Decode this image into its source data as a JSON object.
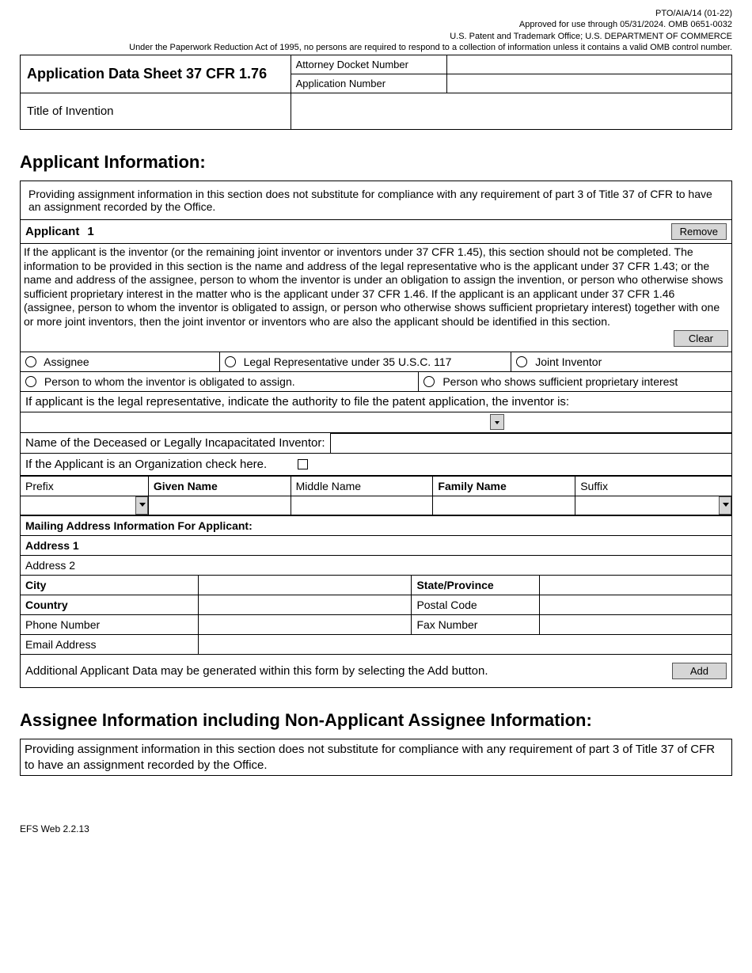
{
  "meta": {
    "form_id": "PTO/AIA/14 (01-22)",
    "approval": "Approved for use through 05/31/2024.  OMB 0651-0032",
    "agency": "U.S. Patent and Trademark Office; U.S. DEPARTMENT OF COMMERCE",
    "pra": "Under the Paperwork Reduction Act of 1995, no persons are required to respond to a collection of information unless it contains a valid OMB control number."
  },
  "header": {
    "title": "Application Data Sheet 37 CFR 1.76",
    "docket_label": "Attorney Docket Number",
    "appnum_label": "Application Number",
    "title_of_invention_label": "Title of Invention",
    "docket_value": "",
    "appnum_value": "",
    "title_value": ""
  },
  "section_applicant_title": "Applicant Information:",
  "assignment_note": "Providing assignment information in this section does not substitute for compliance with any requirement of part 3 of Title 37 of CFR to have an assignment recorded by the Office.",
  "applicant_label": "Applicant",
  "applicant_number": "1",
  "remove_label": "Remove",
  "clear_label": "Clear",
  "applicant_longtext": "If the applicant is the inventor (or the remaining joint inventor or inventors under 37 CFR 1.45), this section should not be completed. The information to be provided in this section is the name and address of the legal representative who is the applicant under 37 CFR 1.43; or the name and address of the assignee, person to whom the inventor is under an obligation to assign the invention, or person who otherwise shows sufficient proprietary interest in the matter who is the applicant under 37 CFR 1.46. If the applicant is an applicant under 37 CFR 1.46 (assignee, person to whom the inventor is obligated to assign, or person who otherwise shows sufficient proprietary interest) together with one or more joint inventors, then the joint inventor or inventors who are also the applicant should be identified in this section.",
  "radios": {
    "assignee": "Assignee",
    "legal_rep": "Legal Representative under  35 U.S.C. 117",
    "joint": "Joint Inventor",
    "obligated": "Person to whom the inventor is obligated to assign.",
    "proprietary": "Person who shows sufficient proprietary interest"
  },
  "authority_text": "If applicant is the legal representative, indicate the authority to file the patent application, the inventor is:",
  "deceased_label": "Name of the Deceased or Legally Incapacitated Inventor:",
  "org_check_label": "If the Applicant is an Organization check here.",
  "name_cols": {
    "prefix": "Prefix",
    "given": "Given Name",
    "middle": "Middle Name",
    "family": "Family Name",
    "suffix": "Suffix"
  },
  "mailing_header": "Mailing Address Information For Applicant:",
  "addr": {
    "address1": "Address 1",
    "address2": "Address 2",
    "city": "City",
    "state": "State/Province",
    "country": "Country",
    "postal": "Postal Code",
    "phone": "Phone Number",
    "fax": "Fax Number",
    "email": "Email Address"
  },
  "add_row_text": "Additional Applicant Data may be generated within this form by selecting the Add button.",
  "add_label": "Add",
  "section_assignee_title": "Assignee Information including Non-Applicant Assignee Information:",
  "assignee_note": "Providing assignment information in this section does not substitute for compliance with any requirement of part 3 of Title 37 of CFR to have an assignment recorded by the Office.",
  "footer": "EFS Web 2.2.13"
}
